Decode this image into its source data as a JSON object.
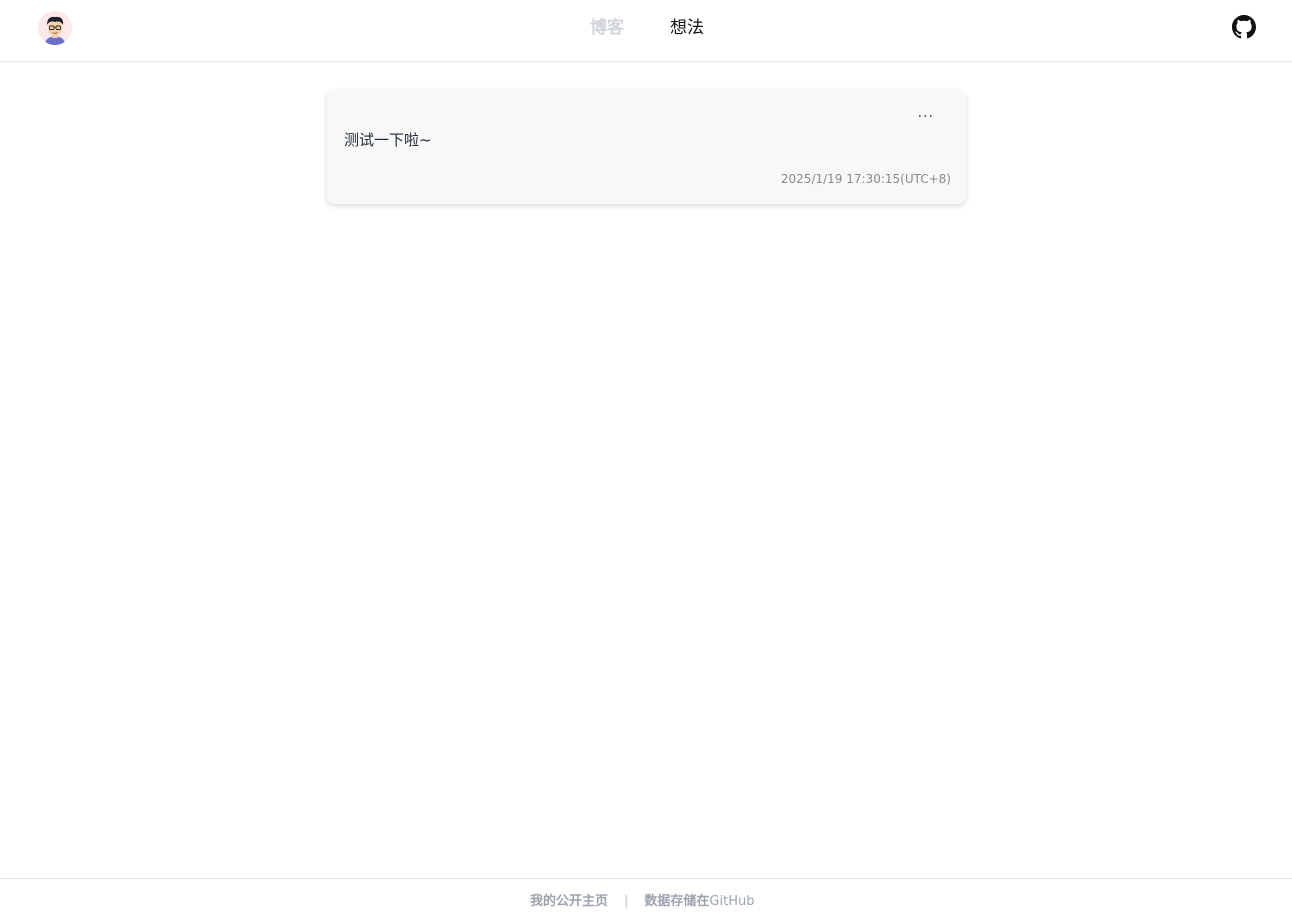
{
  "header": {
    "nav": [
      {
        "label": "博客",
        "active": false
      },
      {
        "label": "想法",
        "active": true
      }
    ],
    "github_icon": "github-icon",
    "avatar_icon": "avatar"
  },
  "thought": {
    "content": "测试一下啦~",
    "timestamp": "2025/1/19 17:30:15(UTC+8)",
    "menu_label": "···"
  },
  "footer": {
    "homepage_label": "我的公开主页",
    "separator": "|",
    "storage_prefix": "数据存储在",
    "storage_github": "GitHub"
  },
  "colors": {
    "nav_inactive": "#d1d5db",
    "nav_active": "#111111",
    "card_bg": "#f8f8f8"
  }
}
